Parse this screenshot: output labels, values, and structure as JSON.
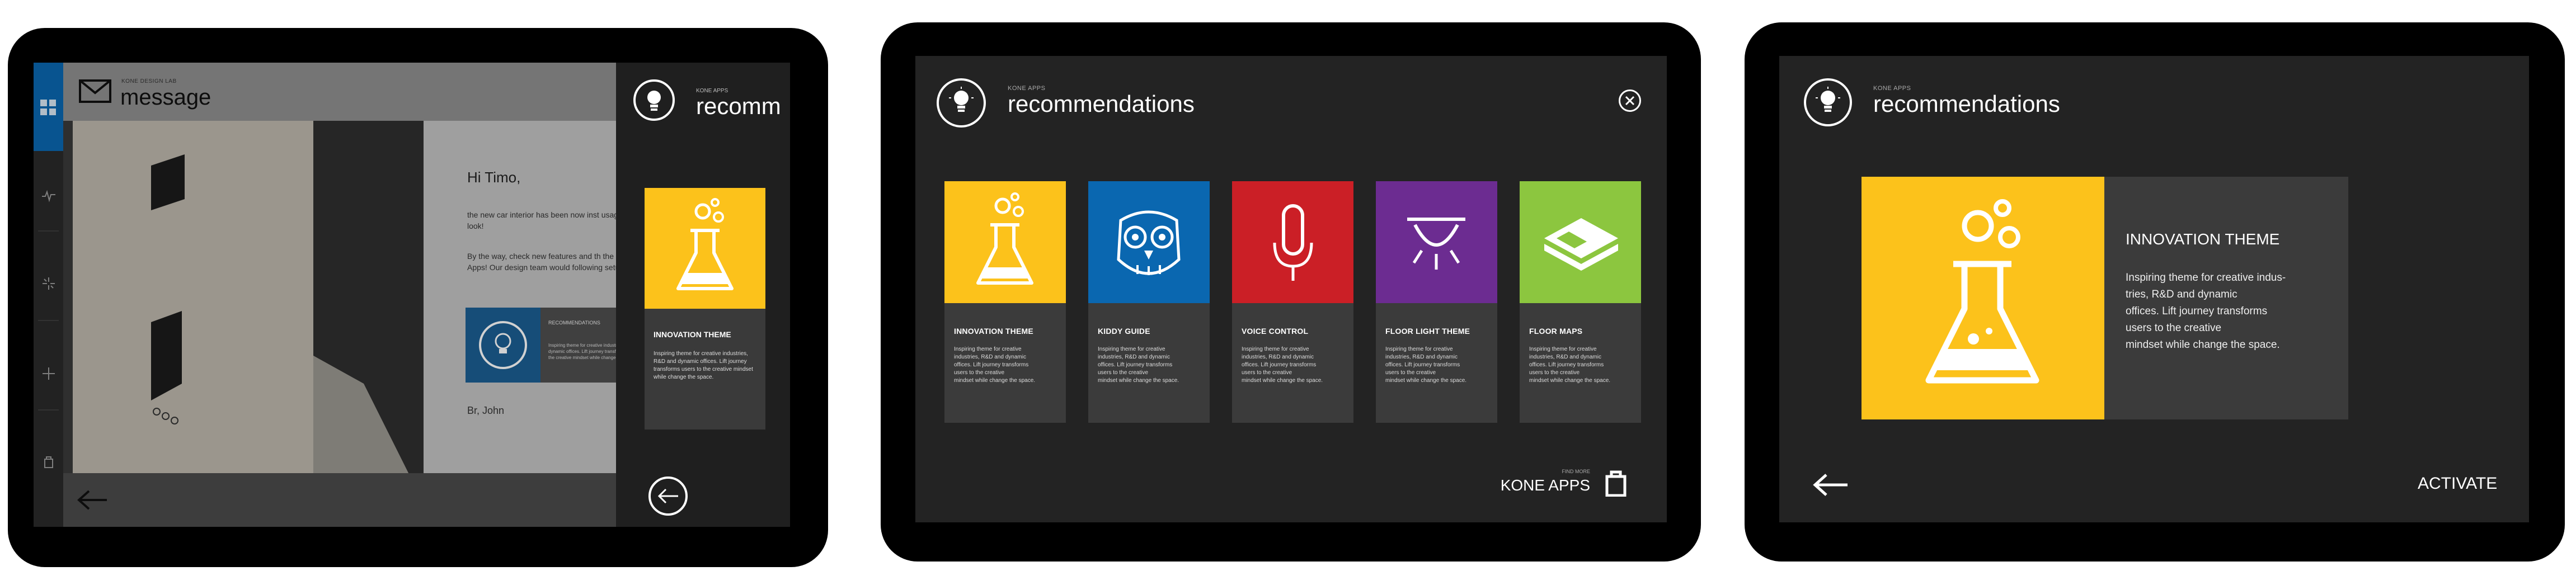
{
  "screen1": {
    "app_label": "KONE DESIGN LAB",
    "title": "message",
    "greeting": "Hi Timo,",
    "para1": "the new car interior has been now inst usage. Have a look!",
    "para2": "By the way, check new features and th the KONE Apps! Our design team would following setup:",
    "embed_label": "RECOMMENDATIONS",
    "embed_text": "Inspiring theme for creative industries, R&D and dynamic offices. Lift journey transforms users to the creative mindset while change the space.",
    "signoff": "Br, John",
    "panel_label": "KONE APPS",
    "panel_title": "recomm",
    "card_title": "INNOVATION THEME",
    "card_desc": "Inspiring theme for creative industries, R&D and dynamic offices. Lift journey transforms users to the creative mindset while change the space."
  },
  "screen2": {
    "app_label": "KONE APPS",
    "title": "recommendations",
    "tiles": [
      {
        "title": "INNOVATION THEME",
        "desc": "Inspiring theme for creative\nindustries, R&D and dynamic\noffices. Lift journey transforms\nusers to the creative\nmindset while change the space.",
        "color": "#fcc21b"
      },
      {
        "title": "KIDDY GUIDE",
        "desc": "Inspiring theme for creative\nindustries, R&D and dynamic\noffices. Lift journey transforms\nusers to the creative\nmindset while change the space.",
        "color": "#0a67b0"
      },
      {
        "title": "VOICE CONTROL",
        "desc": "Inspiring theme for creative\nindustries, R&D and dynamic\noffices. Lift journey transforms\nusers to the creative\nmindset while change the space.",
        "color": "#cb1f26"
      },
      {
        "title": "FLOOR  LIGHT THEME",
        "desc": "Inspiring theme for creative\nindustries, R&D and dynamic\noffices. Lift journey transforms\nusers to the creative\nmindset while change the space.",
        "color": "#6c2c91"
      },
      {
        "title": "FLOOR MAPS",
        "desc": "Inspiring theme for creative\nindustries, R&D and dynamic\noffices. Lift journey transforms\nusers to the creative\nmindset while change the space.",
        "color": "#8cc63f"
      }
    ],
    "find_more": "FIND MORE",
    "kone_apps": "KONE APPS"
  },
  "screen3": {
    "app_label": "KONE APPS",
    "title": "recommendations",
    "detail_title": "INNOVATION THEME",
    "detail_desc": "Inspiring theme for creative indus-\ntries, R&D and dynamic\noffices. Lift journey transforms\nusers to the creative\nmindset while change the space.",
    "activate": "ACTIVATE",
    "accent": "#fcc21b"
  }
}
